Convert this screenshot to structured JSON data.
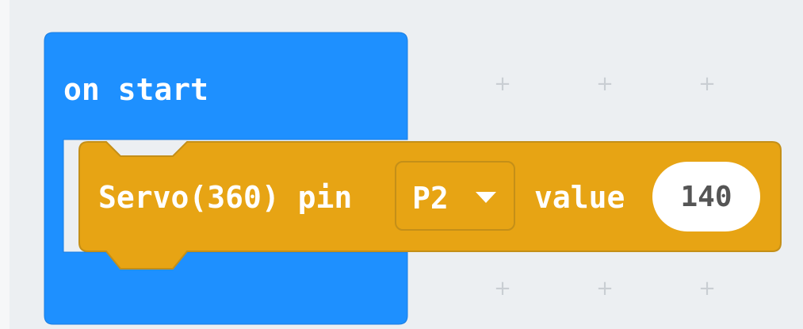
{
  "workspace": {
    "background_color": "#eceff2",
    "grid_marker": "+"
  },
  "on_start_block": {
    "label": "on start",
    "color": "#1e90ff"
  },
  "servo_block": {
    "label": "Servo(360) pin",
    "pin_value": "P2",
    "value_label": "value",
    "value": "140",
    "color": "#e7a414"
  }
}
